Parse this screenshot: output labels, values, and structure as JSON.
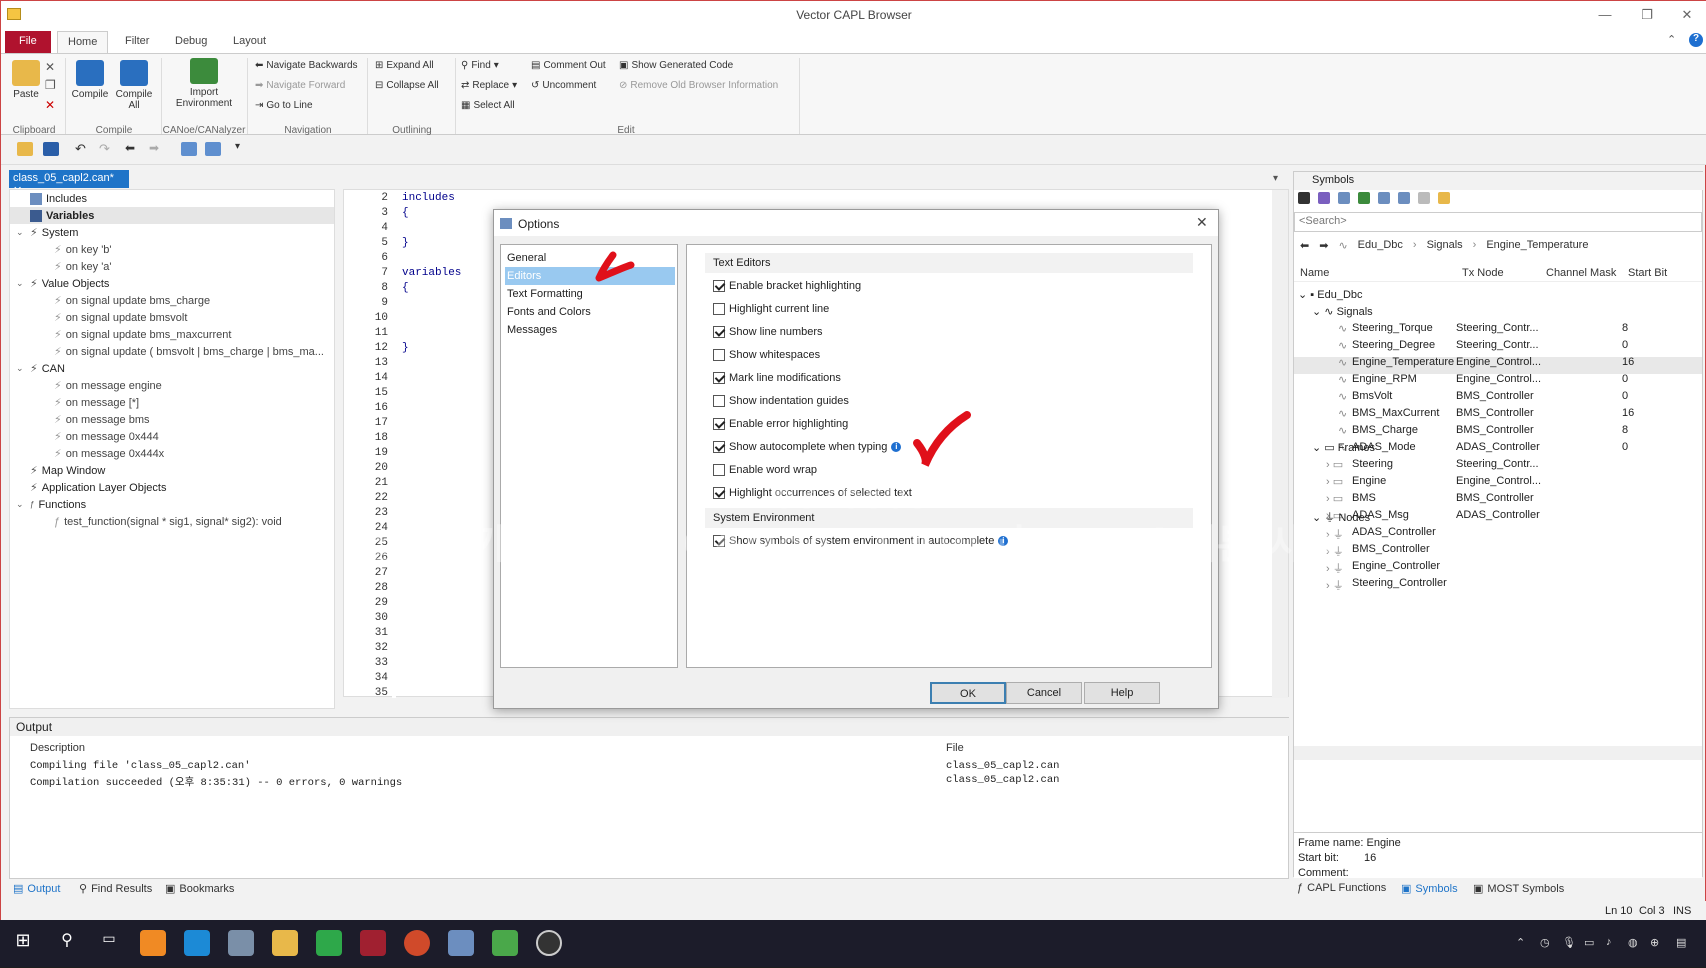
{
  "app": {
    "title": "Vector CAPL Browser"
  },
  "ribbon": {
    "tabs": [
      "File",
      "Home",
      "Filter",
      "Debug",
      "Layout"
    ],
    "clipboard": {
      "paste": "Paste",
      "group": "Clipboard"
    },
    "compile": {
      "compile": "Compile",
      "compile_all": "Compile All",
      "group": "Compile"
    },
    "canoe": {
      "import": "Import Environment",
      "group": "CANoe/CANalyzer"
    },
    "navigation": {
      "back": "Navigate Backwards",
      "forward": "Navigate Forward",
      "goto": "Go to Line",
      "group": "Navigation"
    },
    "outlining": {
      "expand": "Expand All",
      "collapse": "Collapse All",
      "group": "Outlining"
    },
    "edit": {
      "find": "Find",
      "replace": "Replace",
      "select_all": "Select All",
      "comment": "Comment Out",
      "uncomment": "Uncomment",
      "show_generated": "Show Generated Code",
      "remove_old": "Remove Old Browser Information",
      "group": "Edit"
    }
  },
  "document": {
    "tab": "class_05_capl2.can*"
  },
  "tree": {
    "includes": "Includes",
    "variables": "Variables",
    "system": "System",
    "sys_items": [
      "on key 'b'",
      "on key 'a'"
    ],
    "value_objects": "Value Objects",
    "vo_items": [
      "on signal update bms_charge",
      "on signal update bmsvolt",
      "on signal update bms_maxcurrent",
      "on signal update ( bmsvolt | bms_charge | bms_ma..."
    ],
    "can": "CAN",
    "can_items": [
      "on message engine",
      "on message [*]",
      "on message bms",
      "on message 0x444",
      "on message 0x444x"
    ],
    "map_window": "Map Window",
    "app_layer": "Application Layer Objects",
    "functions": "Functions",
    "fn_items": [
      "test_function(signal * sig1, signal* sig2): void"
    ]
  },
  "editor": {
    "line_numbers": [
      "2",
      "3",
      "4",
      "5",
      "6",
      "7",
      "8",
      "9",
      "10",
      "11",
      "12",
      "13",
      "14",
      "15",
      "16",
      "17",
      "18",
      "19",
      "20",
      "21",
      "22",
      "23",
      "24",
      "25",
      "26",
      "27",
      "28",
      "29",
      "30",
      "31",
      "32",
      "33",
      "34",
      "35"
    ],
    "code": {
      "l2": "includes",
      "l3": "{",
      "l5": "}",
      "l7": "variables",
      "l8": "{",
      "l12": "}"
    }
  },
  "output": {
    "title": "Output",
    "col_desc": "Description",
    "col_file": "File",
    "rows": [
      {
        "desc": "Compiling file 'class_05_capl2.can'",
        "file": "class_05_capl2.can"
      },
      {
        "desc": "Compilation succeeded (오후 8:35:31) -- 0 errors, 0 warnings",
        "file": "class_05_capl2.can"
      }
    ]
  },
  "bottom_tabs": [
    "Output",
    "Find Results",
    "Bookmarks"
  ],
  "symbols": {
    "title": "Symbols",
    "search_placeholder": "<Search>",
    "breadcrumb": [
      "Edu_Dbc",
      "Signals",
      "Engine_Temperature"
    ],
    "cols": [
      "Name",
      "Tx Node",
      "Channel Mask",
      "Start Bit"
    ],
    "db": "Edu_Dbc",
    "signals": "Signals",
    "frames": "Frames",
    "nodes": "Nodes",
    "signal_rows": [
      {
        "name": "Steering_Torque",
        "tx": "Steering_Contr...",
        "start": "8"
      },
      {
        "name": "Steering_Degree",
        "tx": "Steering_Contr...",
        "start": "0"
      },
      {
        "name": "Engine_Temperature",
        "tx": "Engine_Control...",
        "start": "16"
      },
      {
        "name": "Engine_RPM",
        "tx": "Engine_Control...",
        "start": "0"
      },
      {
        "name": "BmsVolt",
        "tx": "BMS_Controller",
        "start": "0"
      },
      {
        "name": "BMS_MaxCurrent",
        "tx": "BMS_Controller",
        "start": "16"
      },
      {
        "name": "BMS_Charge",
        "tx": "BMS_Controller",
        "start": "8"
      },
      {
        "name": "ADAS_Mode",
        "tx": "ADAS_Controller",
        "start": "0"
      }
    ],
    "frame_rows": [
      {
        "name": "Steering",
        "tx": "Steering_Contr..."
      },
      {
        "name": "Engine",
        "tx": "Engine_Control..."
      },
      {
        "name": "BMS",
        "tx": "BMS_Controller"
      },
      {
        "name": "ADAS_Msg",
        "tx": "ADAS_Controller"
      }
    ],
    "node_rows": [
      "ADAS_Controller",
      "BMS_Controller",
      "Engine_Controller",
      "Steering_Controller"
    ],
    "footer": {
      "frame_label": "Frame name:",
      "frame_value": "Engine",
      "start_label": "Start bit:",
      "start_value": "16",
      "comment_label": "Comment:"
    },
    "tabs": [
      "CAPL Functions",
      "Symbols",
      "MOST Symbols"
    ]
  },
  "status": {
    "ln": "Ln 10",
    "col": "Col 3",
    "ins": "INS"
  },
  "dialog": {
    "title": "Options",
    "categories": [
      "General",
      "Editors",
      "Text Formatting",
      "Fonts and Colors",
      "Messages"
    ],
    "section_text": "Text Editors",
    "options": [
      {
        "label": "Enable bracket highlighting",
        "checked": true
      },
      {
        "label": "Highlight current line",
        "checked": false
      },
      {
        "label": "Show line numbers",
        "checked": true
      },
      {
        "label": "Show whitespaces",
        "checked": false
      },
      {
        "label": "Mark line modifications",
        "checked": true
      },
      {
        "label": "Show indentation guides",
        "checked": false
      },
      {
        "label": "Enable error highlighting",
        "checked": true
      },
      {
        "label": "Show autocomplete when typing",
        "checked": true
      },
      {
        "label": "Enable word wrap",
        "checked": false
      },
      {
        "label": "Highlight occurrences of selected text",
        "checked": true
      }
    ],
    "section_env": "System Environment",
    "env_option": {
      "label": "Show symbols of system environment in autocomplete",
      "checked": true
    },
    "ok": "OK",
    "cancel": "Cancel",
    "help": "Help"
  },
  "watermark": {
    "line1": "5375803",
    "line2": "실무자가 알려주는 CANoe - CAPL과 Panel 기본 사용",
    "line3": "존버매니아"
  },
  "colors": {
    "accent": "#1f74c8",
    "file_tab": "#b0122e",
    "check_mark": "#e0101a"
  }
}
